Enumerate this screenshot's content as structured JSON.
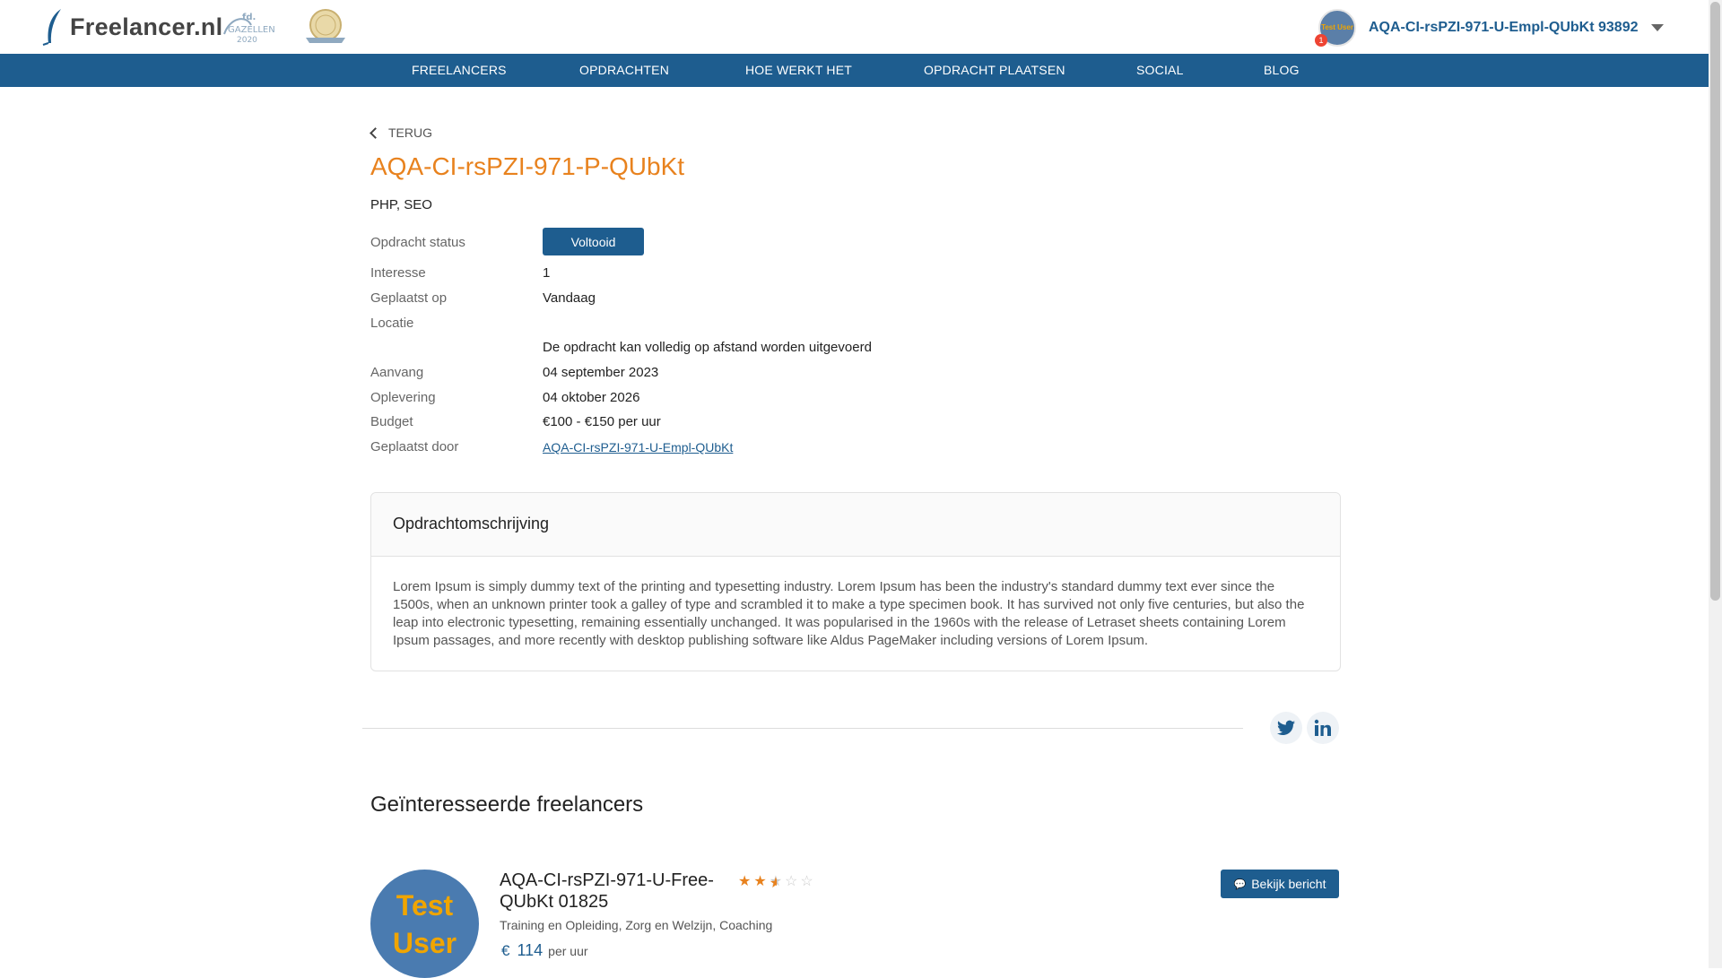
{
  "header": {
    "logo_text": "Freelancer.nl",
    "user_name": "AQA-CI-rsPZI-971-U-Empl-QUbKt 93892",
    "notification_count": "1",
    "avatar_text": "Test User"
  },
  "nav": {
    "items": [
      {
        "label": "FREELANCERS"
      },
      {
        "label": "OPDRACHTEN"
      },
      {
        "label": "HOE WERKT HET"
      },
      {
        "label": "OPDRACHT PLAATSEN"
      },
      {
        "label": "SOCIAL"
      },
      {
        "label": "BLOG"
      }
    ]
  },
  "page": {
    "back_label": "TERUG",
    "title": "AQA-CI-rsPZI-971-P-QUbKt",
    "skills": "PHP, SEO"
  },
  "details": {
    "status_label": "Opdracht status",
    "status_value": "Voltooid",
    "interest_label": "Interesse",
    "interest_value": "1",
    "placed_label": "Geplaatst op",
    "placed_value": "Vandaag",
    "location_label": "Locatie",
    "location_value": "De opdracht kan volledig op afstand worden uitgevoerd",
    "start_label": "Aanvang",
    "start_value": "04 september 2023",
    "delivery_label": "Oplevering",
    "delivery_value": "04 oktober 2026",
    "budget_label": "Budget",
    "budget_value": "€100 - €150 per uur",
    "placed_by_label": "Geplaatst door",
    "placed_by_value": "AQA-CI-rsPZI-971-U-Empl-QUbKt"
  },
  "description": {
    "heading": "Opdrachtomschrijving",
    "body": "Lorem Ipsum is simply dummy text of the printing and typesetting industry. Lorem Ipsum has been the industry's standard dummy text ever since the 1500s, when an unknown printer took a galley of type and scrambled it to make a type specimen book. It has survived not only five centuries, but also the leap into electronic typesetting, remaining essentially unchanged. It was popularised in the 1960s with the release of Letraset sheets containing Lorem Ipsum passages, and more recently with desktop publishing software like Aldus PageMaker including versions of Lorem Ipsum."
  },
  "social": {
    "icons": [
      "twitter-icon",
      "linkedin-icon"
    ]
  },
  "interested": {
    "heading": "Geïnteresseerde freelancers",
    "freelancers": [
      {
        "avatar_line1": "Test",
        "avatar_line2": "User",
        "name": "AQA-CI-rsPZI-971-U-Free-QUbKt 01825",
        "rating": 2.5,
        "rating_max": 5,
        "categories": "Training en Opleiding, Zorg en Welzijn, Coaching",
        "currency": "€",
        "rate": "114",
        "rate_unit": "per uur",
        "message_button": "Bekijk bericht"
      }
    ]
  },
  "colors": {
    "brand_blue": "#1e5d8f",
    "accent_orange": "#e8821e"
  }
}
